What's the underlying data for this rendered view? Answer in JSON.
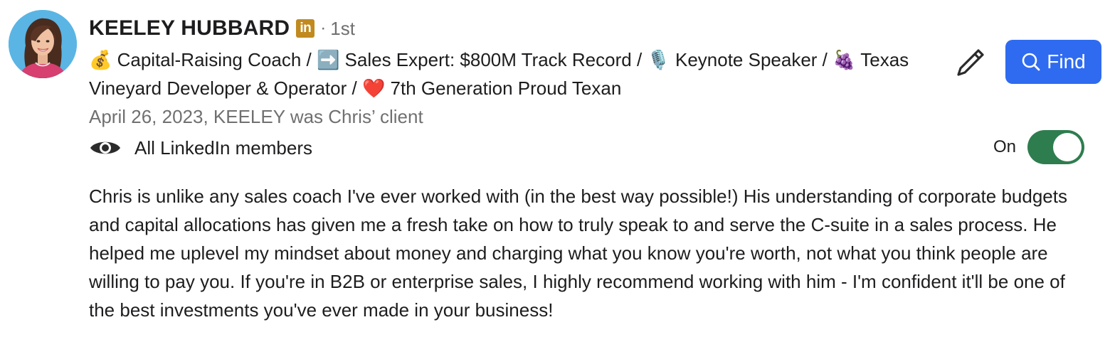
{
  "profile": {
    "name": "KEELEY HUBBARD",
    "badge": "in",
    "separator": "·",
    "degree": "1st",
    "headline": "💰 Capital-Raising Coach / ➡️ Sales Expert: $800M Track Record / 🎙️ Keynote Speaker / 🍇 Texas Vineyard Developer & Operator / ❤️ 7th Generation Proud Texan",
    "relationship": "April 26, 2023, KEELEY was Chris’ client",
    "avatar_icon": "profile-photo"
  },
  "visibility": {
    "icon": "eye-icon",
    "label": "All LinkedIn members"
  },
  "actions": {
    "edit_icon": "pencil-icon",
    "find_label": "Find",
    "find_icon": "search-icon"
  },
  "toggle": {
    "label": "On",
    "state": true
  },
  "recommendation": {
    "text": "Chris is unlike any sales coach I've ever worked with (in the best way possible!) His understanding of corporate budgets and capital allocations has given me a fresh take on how to truly speak to and serve the C-suite in a sales process. He helped me uplevel my mindset about money and charging what you know you're worth, not what you think people are willing to pay you. If you're in B2B or enterprise sales, I highly recommend working with him - I'm confident it'll be one of the best investments you've ever made in your business!"
  },
  "colors": {
    "badge": "#c18a1f",
    "find_button": "#2f6bf0",
    "toggle_on": "#2e7d4f",
    "muted_text": "#707070"
  }
}
